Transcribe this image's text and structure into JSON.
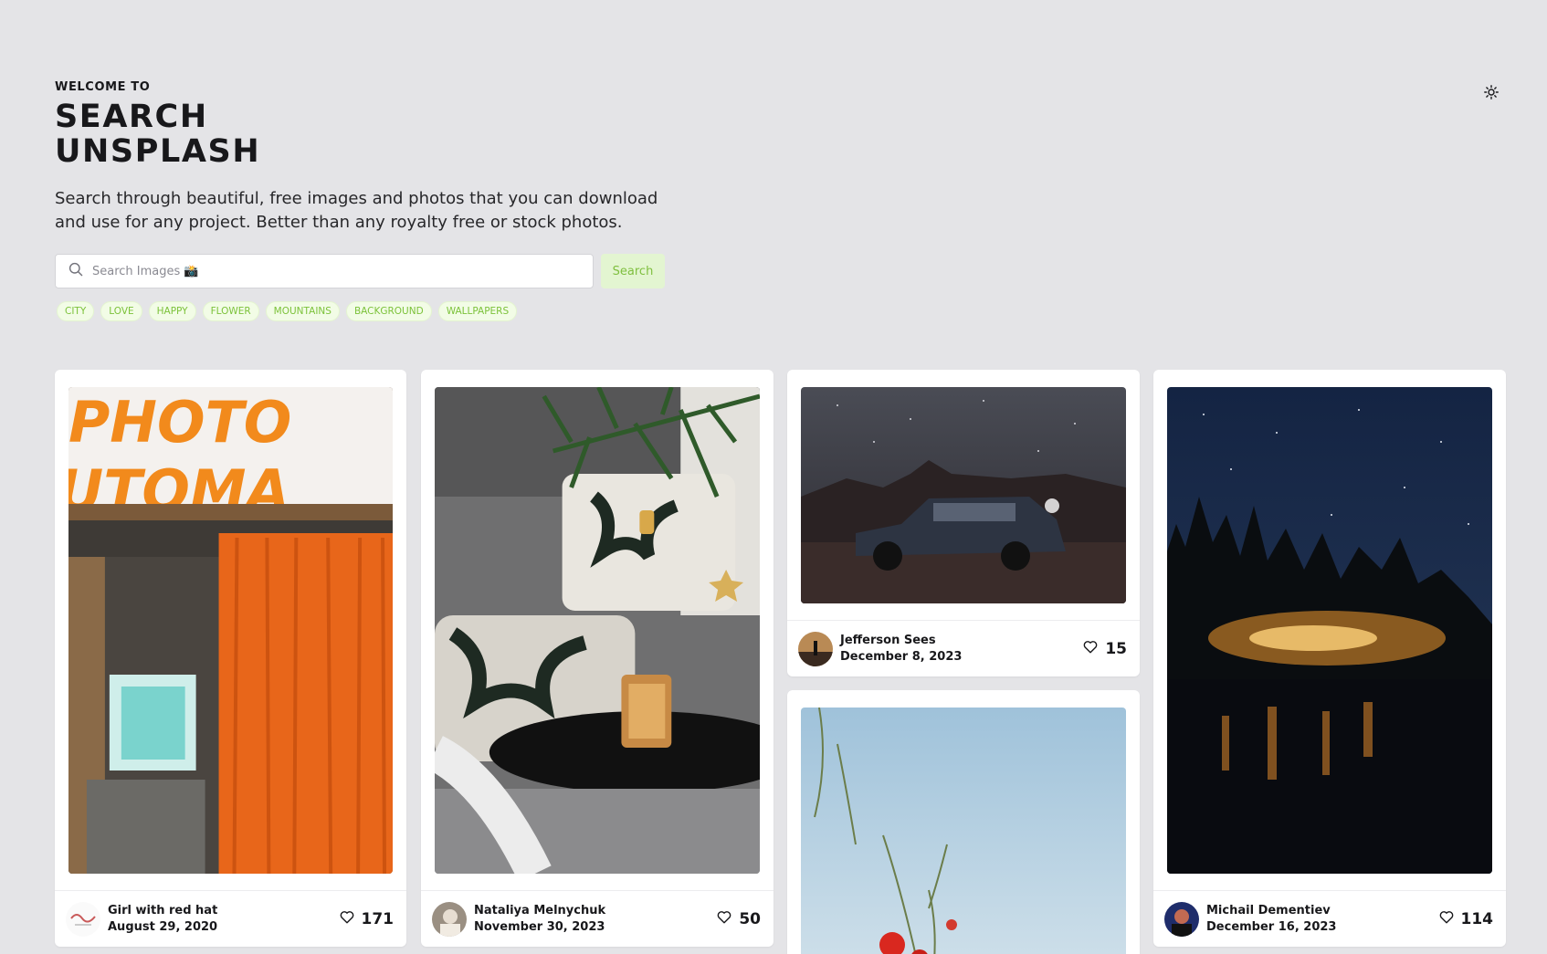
{
  "header": {
    "welcome": "WELCOME TO",
    "title": "SEARCH UNSPLASH",
    "description": "Search through beautiful, free images and photos that you can download and use for any project. Better than any royalty free or stock photos."
  },
  "theme_toggle_icon": "sun-icon",
  "search": {
    "placeholder": "Search Images 📸",
    "value": "",
    "button_label": "Search"
  },
  "tags": [
    "CITY",
    "LOVE",
    "HAPPY",
    "FLOWER",
    "MOUNTAINS",
    "BACKGROUND",
    "WALLPAPERS"
  ],
  "colors": {
    "background": "#e4e4e7",
    "accent": "#7cc23a",
    "tag_bg": "#f2fce6",
    "button_bg": "#e3f5d1"
  },
  "cards": [
    {
      "author": "Girl with red hat",
      "date": "August 29, 2020",
      "likes": "171",
      "photo": "orange curtain photo booth with 'PHOTO AUTOMAT' sign"
    },
    {
      "author": "Nataliya Melnychuk",
      "date": "November 30, 2023",
      "likes": "50",
      "photo": "christmas tree branch, pillow and candle on sofa"
    },
    {
      "author": "Jefferson Sees",
      "date": "December 8, 2023",
      "likes": "15",
      "photo": "SUV under starry night sky in desert"
    },
    {
      "author": "Michail Dementiev",
      "date": "December 16, 2023",
      "likes": "114",
      "photo": "campfire by forest lake under night sky"
    },
    {
      "author": "",
      "date": "",
      "likes": "",
      "photo": "red poppies against blue sky"
    }
  ]
}
